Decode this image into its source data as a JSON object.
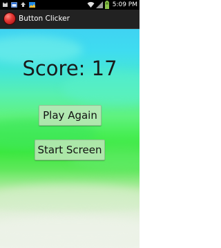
{
  "status_bar": {
    "time": "5:09 PM",
    "left_icons": [
      "cat-icon",
      "calendar-icon",
      "upload-icon",
      "landscape-icon"
    ],
    "right_icons": [
      "wifi-icon",
      "signal-icon",
      "battery-icon"
    ]
  },
  "action_bar": {
    "title": "Button Clicker",
    "icon": "red-ball-icon"
  },
  "main": {
    "score_text": "Score: 17",
    "play_again_label": "Play Again",
    "start_screen_label": "Start Screen"
  },
  "colors": {
    "status_bar_bg": "#000000",
    "action_bar_bg": "#222222",
    "app_icon": "#e53935",
    "sky": "#3fd3f2",
    "grass": "#3be83e",
    "button_bg": "#bee6b9",
    "text": "#1a1a1a"
  }
}
